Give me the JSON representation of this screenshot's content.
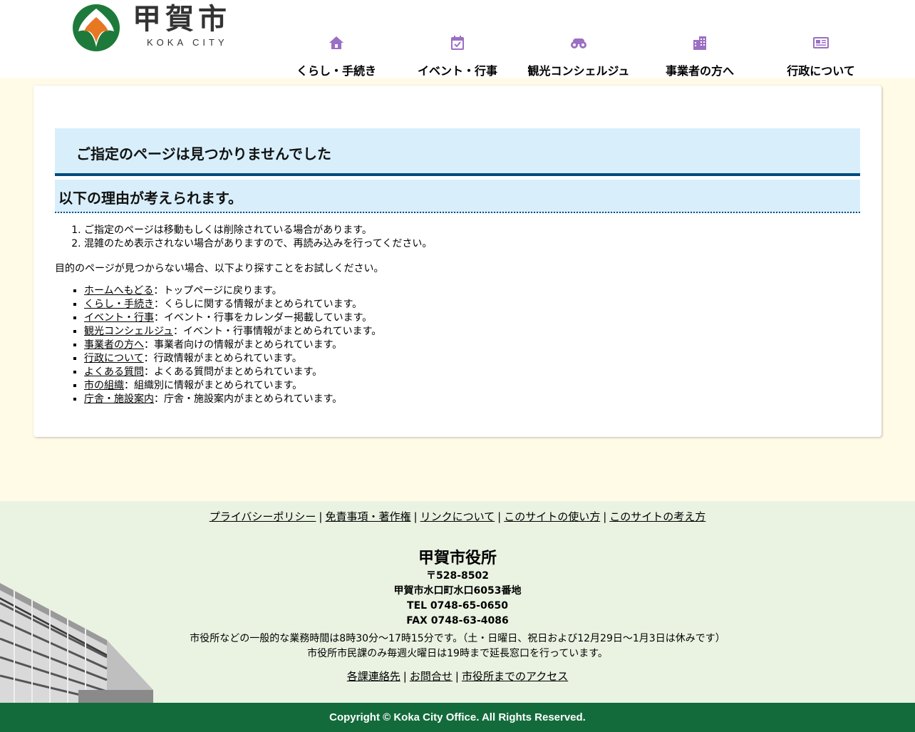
{
  "header": {
    "logo_name": "甲賀市",
    "logo_sub": "KOKA CITY",
    "nav": [
      {
        "label": "くらし・手続き",
        "icon": "house-icon"
      },
      {
        "label": "イベント・行事",
        "icon": "calendar-check-icon"
      },
      {
        "label": "観光コンシェルジュ",
        "icon": "binoculars-icon"
      },
      {
        "label": "事業者の方へ",
        "icon": "building-icon"
      },
      {
        "label": "行政について",
        "icon": "newspaper-icon"
      }
    ],
    "accent": "#9b6fc4"
  },
  "main": {
    "title": "ご指定のページは見つかりませんでした",
    "subtitle": "以下の理由が考えられます。",
    "reasons": [
      "ご指定のページは移動もしくは削除されている場合があります。",
      "混雑のため表示されない場合がありますので、再読み込みを行ってください。"
    ],
    "hint": "目的のページが見つからない場合、以下より探すことをお試しください。",
    "links": [
      {
        "label": "ホームへもどる",
        "desc": "：トップページに戻ります。"
      },
      {
        "label": "くらし・手続き",
        "desc": "：くらしに関する情報がまとめられています。"
      },
      {
        "label": "イベント・行事",
        "desc": "：イベント・行事をカレンダー掲載しています。"
      },
      {
        "label": "観光コンシェルジュ",
        "desc": "：イベント・行事情報がまとめられています。"
      },
      {
        "label": "事業者の方へ",
        "desc": "：事業者向けの情報がまとめられています。"
      },
      {
        "label": "行政について",
        "desc": "：行政情報がまとめられています。"
      },
      {
        "label": "よくある質問",
        "desc": "：よくある質問がまとめられています。"
      },
      {
        "label": "市の組織",
        "desc": "：組織別に情報がまとめられています。"
      },
      {
        "label": "庁舎・施設案内",
        "desc": "：庁舎・施設案内がまとめられています。"
      }
    ]
  },
  "footer": {
    "links": [
      "プライバシーポリシー",
      "免責事項・著作権",
      "リンクについて",
      "このサイトの使い方",
      "このサイトの考え方"
    ],
    "office": "甲賀市役所",
    "postal": "〒528-8502",
    "address": "甲賀市水口町水口6053番地",
    "tel": "TEL 0748-65-0650",
    "fax": "FAX 0748-63-4086",
    "hours1": "市役所などの一般的な業務時間は8時30分～17時15分です。（土・日曜日、祝日および12月29日～1月3日は休みです）",
    "hours2": "市役所市民課のみ毎週火曜日は19時まで延長窓口を行っています。",
    "links2": [
      "各課連絡先",
      "お問合せ",
      "市役所までのアクセス"
    ],
    "copyright": "Copyright © Koka City Office. All Rights Reserved.",
    "bg_color": "#eaf3e2",
    "copyright_bg": "#136b3c"
  }
}
